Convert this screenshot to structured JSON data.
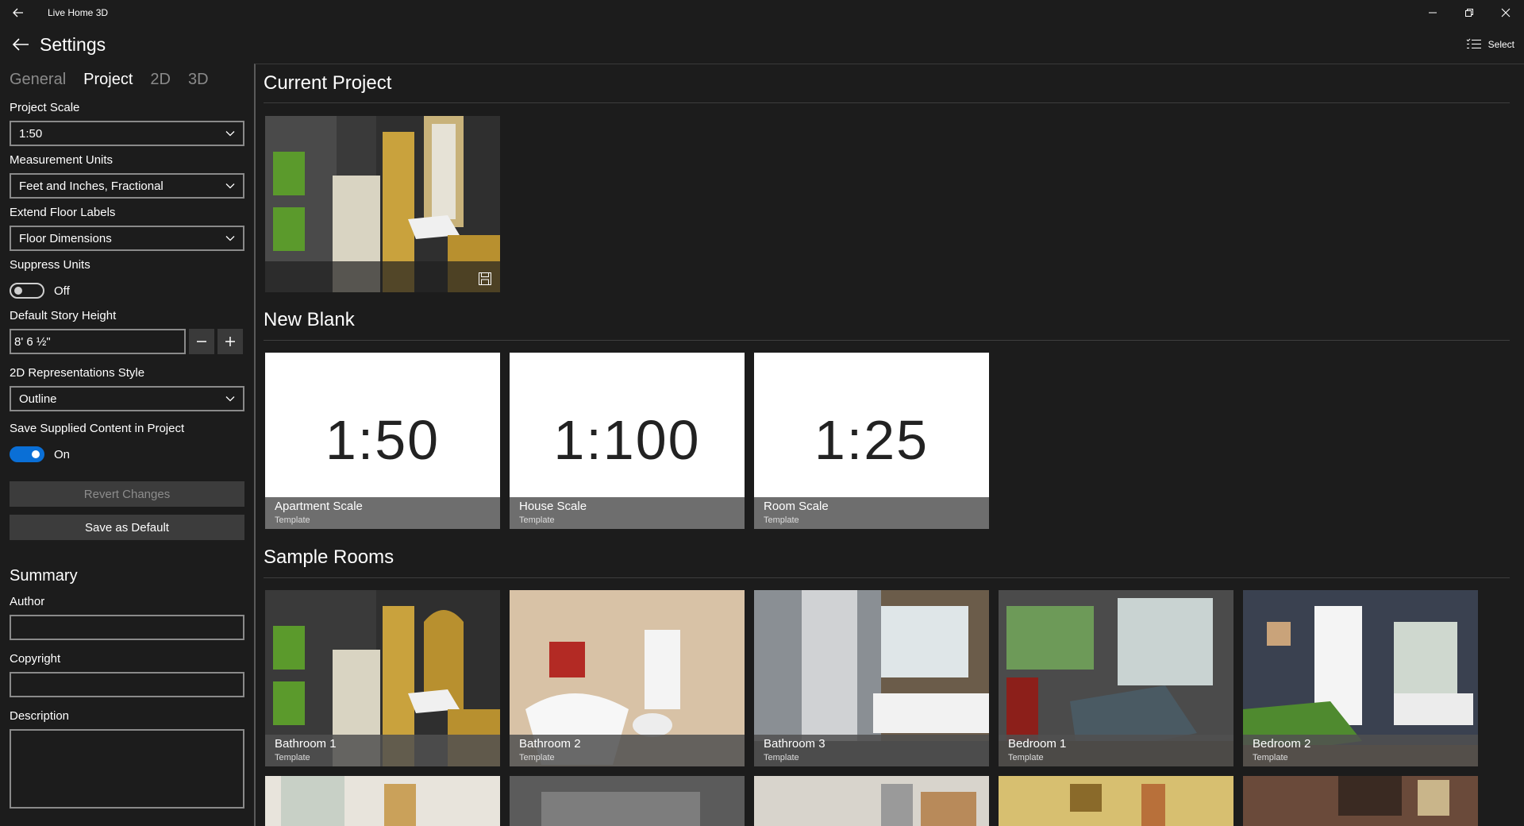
{
  "window": {
    "title": "Live Home 3D"
  },
  "header": {
    "title": "Settings",
    "select_label": "Select"
  },
  "tabs": [
    {
      "label": "General",
      "active": false
    },
    {
      "label": "Project",
      "active": true
    },
    {
      "label": "2D",
      "active": false
    },
    {
      "label": "3D",
      "active": false
    }
  ],
  "settings": {
    "project_scale": {
      "label": "Project Scale",
      "value": "1:50"
    },
    "measurement_units": {
      "label": "Measurement Units",
      "value": "Feet and Inches, Fractional"
    },
    "extend_floor_labels": {
      "label": "Extend Floor Labels",
      "value": "Floor Dimensions"
    },
    "suppress_units": {
      "label": "Suppress Units",
      "state": "Off"
    },
    "story_height": {
      "label": "Default Story Height",
      "value": "8' 6 ½\""
    },
    "representation_style": {
      "label": "2D Representations Style",
      "value": "Outline"
    },
    "save_content": {
      "label": "Save Supplied Content in Project",
      "state": "On"
    },
    "revert_label": "Revert Changes",
    "save_default_label": "Save as Default"
  },
  "summary": {
    "title": "Summary",
    "author_label": "Author",
    "copyright_label": "Copyright",
    "description_label": "Description"
  },
  "sections": {
    "current": "Current Project",
    "blank": "New Blank",
    "samples": "Sample Rooms"
  },
  "blank_templates": [
    {
      "scale": "1:50",
      "name": "Apartment Scale",
      "sub": "Template"
    },
    {
      "scale": "1:100",
      "name": "House Scale",
      "sub": "Template"
    },
    {
      "scale": "1:25",
      "name": "Room Scale",
      "sub": "Template"
    }
  ],
  "sample_rooms": [
    {
      "name": "Bathroom 1",
      "sub": "Template"
    },
    {
      "name": "Bathroom 2",
      "sub": "Template"
    },
    {
      "name": "Bathroom 3",
      "sub": "Template"
    },
    {
      "name": "Bedroom 1",
      "sub": "Template"
    },
    {
      "name": "Bedroom 2",
      "sub": "Template"
    }
  ],
  "colors": {
    "accent": "#0a6fd6",
    "background": "#1c1c1c"
  },
  "icons": [
    "back-arrow-icon",
    "minimize-icon",
    "restore-icon",
    "close-icon",
    "select-list-icon",
    "chevron-down-icon",
    "minus-icon",
    "plus-icon",
    "save-icon"
  ]
}
